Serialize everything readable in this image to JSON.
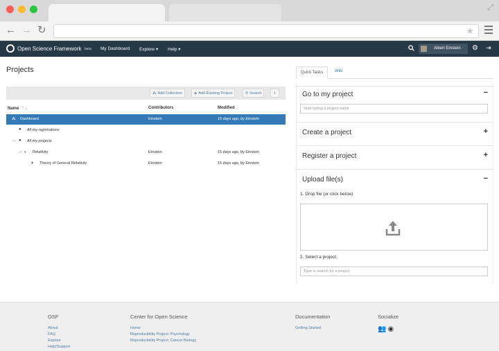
{
  "browser": {
    "url": ""
  },
  "nav": {
    "brand": "Open Science Framework",
    "beta": "beta",
    "items": [
      "My Dashboard",
      "Explore ▾",
      "Help ▾"
    ],
    "user_name": "Albert Einstein",
    "bg_color": "#263947"
  },
  "page": {
    "title": "Projects"
  },
  "toolbar": {
    "add_collection": "Add Collection",
    "add_existing": "Add Existing Project",
    "search": "Search",
    "info": "i"
  },
  "tree": {
    "columns": [
      "Name",
      "Contributors",
      "Modified"
    ],
    "rows": [
      {
        "name": "Dashboard",
        "contributors": "Einstein",
        "modified": "15 days ago, by Einstein",
        "selected": true
      },
      {
        "name": "All my registrations",
        "contributors": "",
        "modified": "",
        "selected": false
      },
      {
        "name": "All my projects",
        "contributors": "",
        "modified": "",
        "selected": false
      },
      {
        "name": "Relativity",
        "contributors": "Einstein",
        "modified": "15 days ago, by Einstein",
        "selected": false
      },
      {
        "name": "Theory of General Relativity",
        "contributors": "Einstein",
        "modified": "15 days ago, by Einstein",
        "selected": false
      }
    ],
    "selected_color": "#337ab7"
  },
  "side": {
    "tabs": [
      "Quick Tasks",
      "Wiki"
    ],
    "go_to_project": "Go to my project",
    "go_placeholder": "Start typing a project name",
    "create_project": "Create a project",
    "register_project": "Register a project",
    "upload_files": "Upload file(s)",
    "step1": "1. Drop file (or click below)",
    "step2": "2. Select a project",
    "search_placeholder": "Type to search for a project",
    "collapse_symbol": "−",
    "expand_symbol": "+"
  },
  "footer": {
    "cols": [
      {
        "title": "OSF",
        "links": [
          "About",
          "FAQ",
          "Explore",
          "Help/Support"
        ]
      },
      {
        "title": "Center for Open Science",
        "links": [
          "Home",
          "Reproducibility Project: Psychology",
          "Reproducibility Project: Cancer Biology"
        ]
      },
      {
        "title": "Documentation",
        "links": [
          "Getting Started"
        ]
      },
      {
        "title": "Socialize",
        "links": []
      }
    ]
  }
}
